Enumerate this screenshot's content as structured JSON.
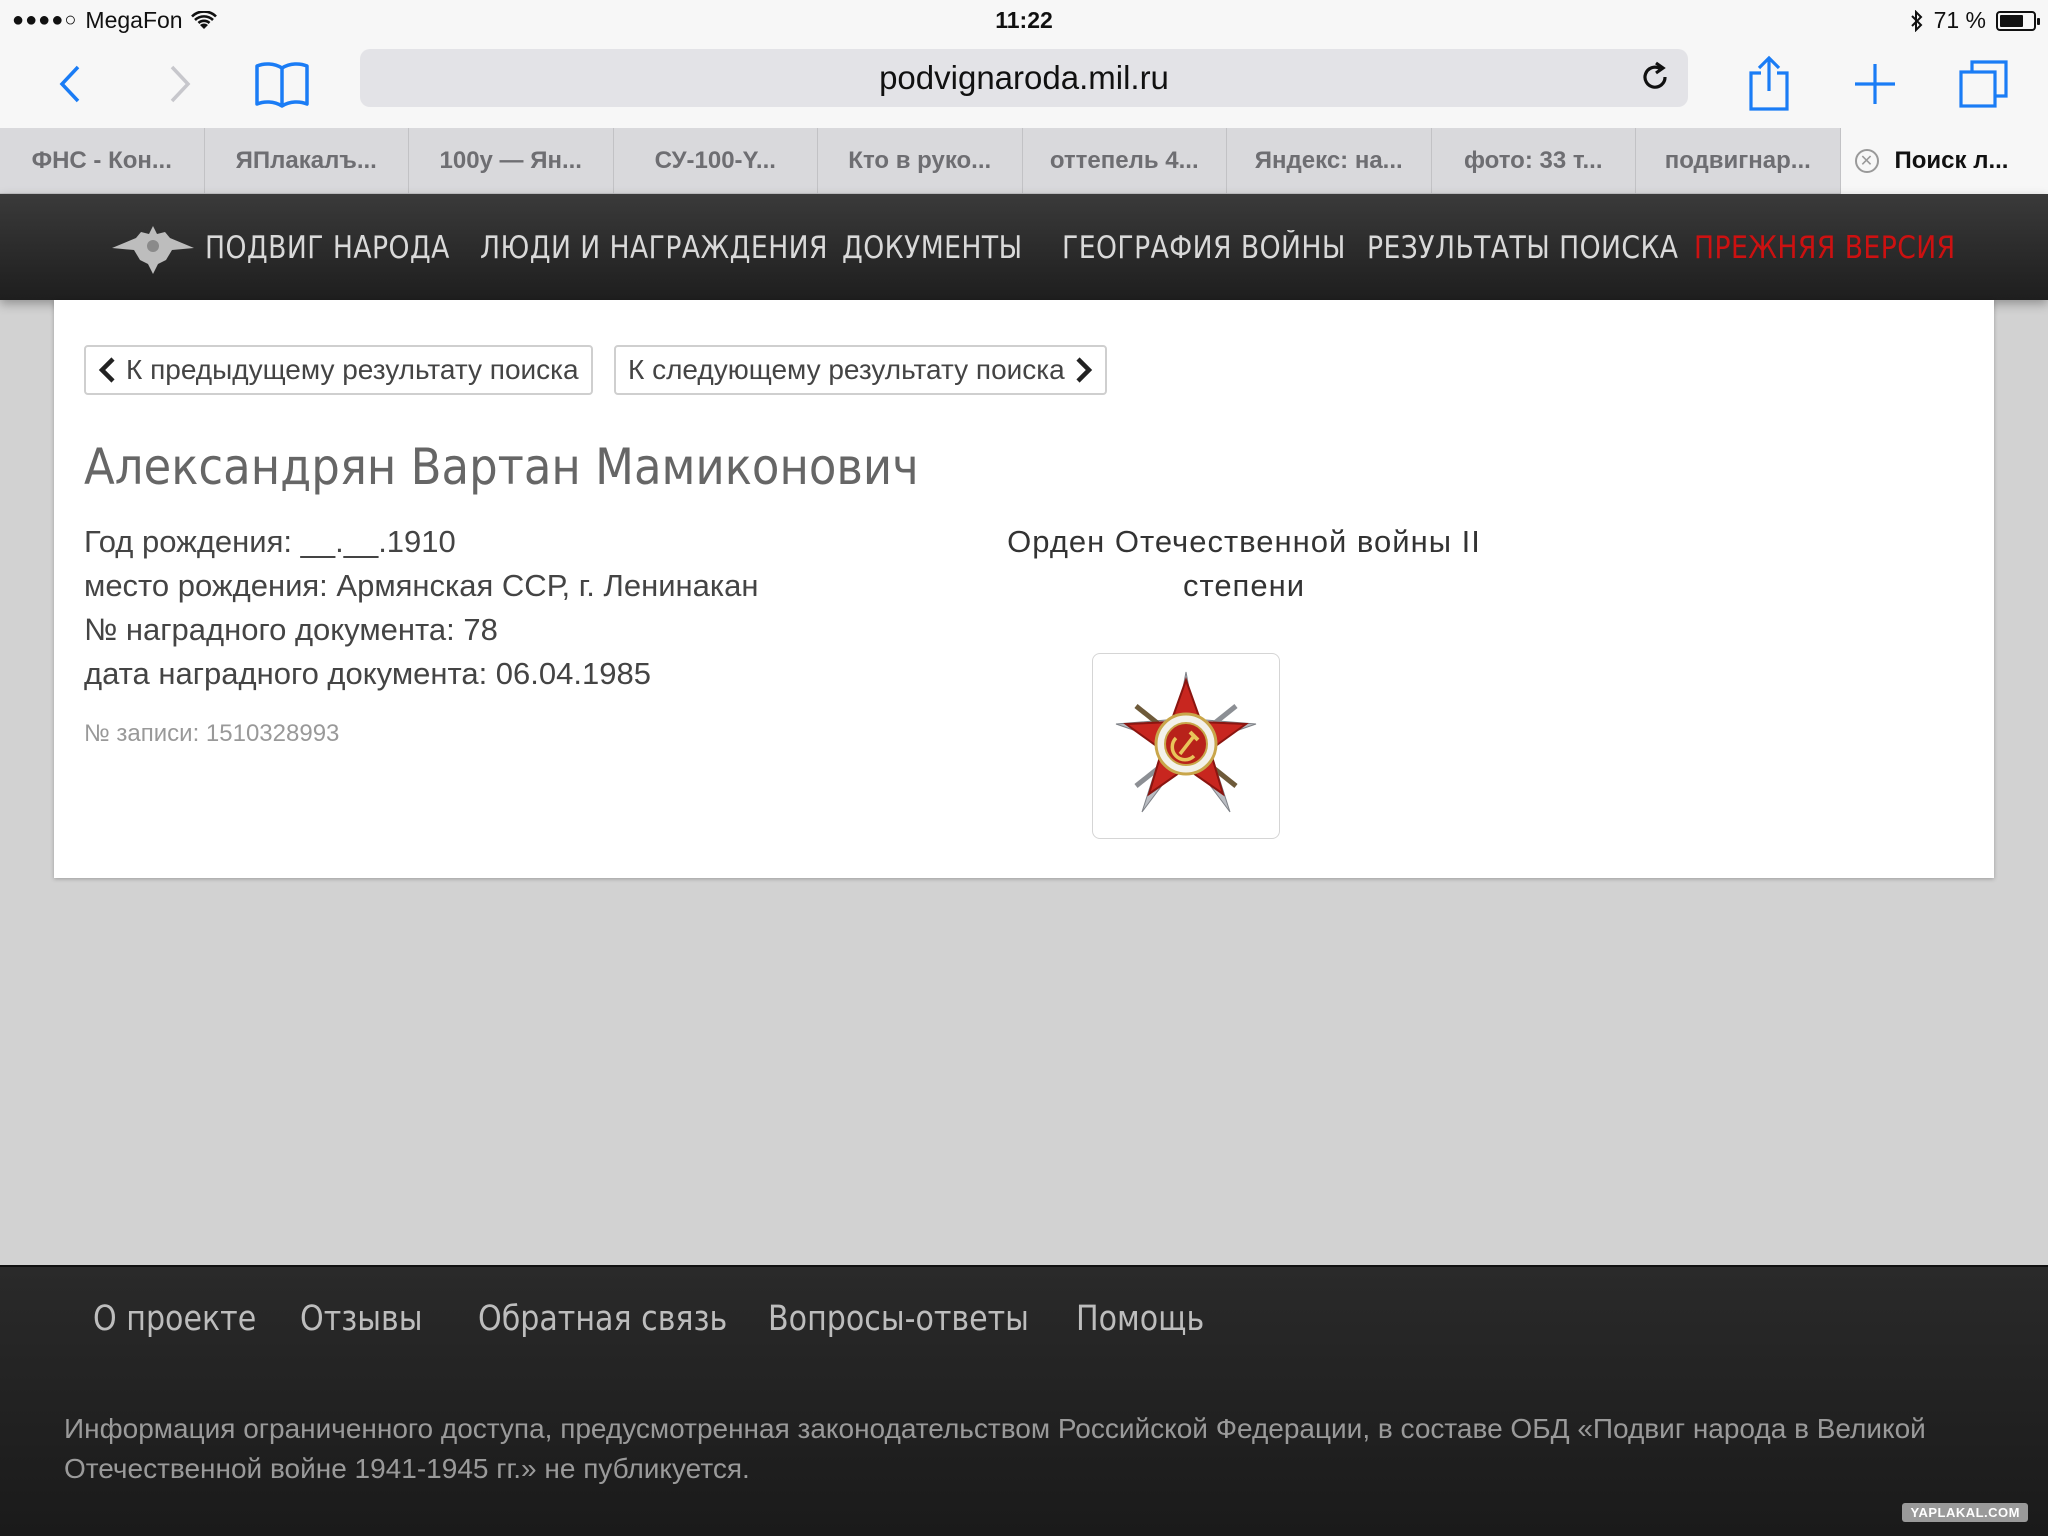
{
  "status_bar": {
    "carrier": "MegaFon",
    "time": "11:22",
    "battery": "71 %",
    "battery_fraction": 0.71
  },
  "toolbar": {
    "url": "podvignaroda.mil.ru",
    "back_icon": "chevron-left-icon",
    "forward_icon": "chevron-right-icon",
    "bookmarks_icon": "book-icon",
    "reload_icon": "reload-icon",
    "share_icon": "share-icon",
    "new_tab_icon": "plus-icon",
    "tabs_icon": "tabs-icon",
    "accent_color": "#1a7cf5"
  },
  "tabs": [
    {
      "label": "ФНС - Кон..."
    },
    {
      "label": "ЯПлакалъ..."
    },
    {
      "label": "100y — Ян..."
    },
    {
      "label": "СУ-100-Y..."
    },
    {
      "label": "Кто в руко..."
    },
    {
      "label": "оттепель 4..."
    },
    {
      "label": "Яндекс: на..."
    },
    {
      "label": "фото: 33 т..."
    },
    {
      "label": "подвигнар..."
    },
    {
      "label": "Поиск л...",
      "active": true
    }
  ],
  "site_nav": {
    "items": [
      {
        "label": "ПОДВИГ НАРОДА"
      },
      {
        "label": "ЛЮДИ И НАГРАЖДЕНИЯ"
      },
      {
        "label": "ДОКУМЕНТЫ"
      },
      {
        "label": "ГЕОГРАФИЯ ВОЙНЫ"
      },
      {
        "label": "РЕЗУЛЬТАТЫ ПОИСКА"
      },
      {
        "label": "ПРЕЖНЯЯ ВЕРСИЯ"
      }
    ],
    "highlight_color": "#cc1111"
  },
  "record": {
    "prev_label": "К предыдущему результату поиска",
    "next_label": "К следующему результату поиска",
    "name": "Александрян Вартан Мамиконович",
    "birth_year": "Год рождения: __.__.1910",
    "birth_place": "место рождения: Армянская ССР, г. Ленинакан",
    "doc_number": "№ наградного документа: 78",
    "doc_date": "дата наградного документа: 06.04.1985",
    "record_number": "№ записи: 1510328993",
    "award_line1": "Орден Отечественной войны II",
    "award_line2": "степени",
    "award_icon": "order-patriotic-war-icon"
  },
  "footer": {
    "links": [
      {
        "label": "О проекте"
      },
      {
        "label": "Отзывы"
      },
      {
        "label": "Обратная связь"
      },
      {
        "label": "Вопросы-ответы"
      },
      {
        "label": "Помощь"
      }
    ],
    "notice_line1": "Информация ограниченного доступа, предусмотренная законодательством Российской Федерации, в составе ОБД «Подвиг народа в Великой",
    "notice_line2": "Отечественной войне 1941-1945 гг.» не публикуется.",
    "watermark": "YAPLAKAL.COM"
  }
}
